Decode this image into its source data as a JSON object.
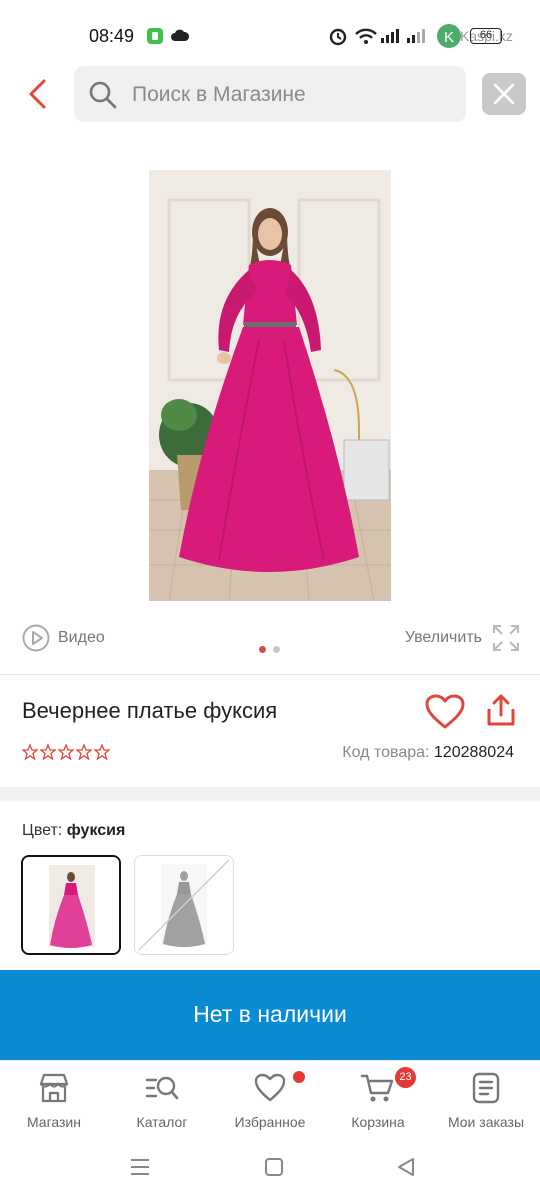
{
  "status_bar": {
    "time": "08:49",
    "battery": "66",
    "watermark": "Kaspi.kz"
  },
  "search": {
    "placeholder": "Поиск в Магазине"
  },
  "gallery": {
    "video_label": "Видео",
    "zoom_label": "Увеличить",
    "page_count": 2,
    "active_page": 1
  },
  "product": {
    "title": "Вечернее платье фуксия",
    "rating_stars": 0,
    "sku_label": "Код товара:",
    "sku_value": "120288024"
  },
  "color": {
    "label": "Цвет:",
    "selected": "фуксия",
    "options": [
      {
        "name": "фуксия",
        "available": true,
        "selected": true
      },
      {
        "name": "black",
        "available": false,
        "selected": false
      }
    ]
  },
  "stock_button": "Нет в наличии",
  "tabs": [
    {
      "label": "Магазин",
      "icon": "store-icon"
    },
    {
      "label": "Каталог",
      "icon": "catalog-search-icon"
    },
    {
      "label": "Избранное",
      "icon": "heart-icon",
      "dot": true
    },
    {
      "label": "Корзина",
      "icon": "cart-icon",
      "badge": "23"
    },
    {
      "label": "Мои заказы",
      "icon": "orders-icon"
    }
  ],
  "colors": {
    "accent_red": "#e0463a",
    "primary_blue": "#0a8bd4",
    "dress_fuchsia": "#d81b7a"
  }
}
